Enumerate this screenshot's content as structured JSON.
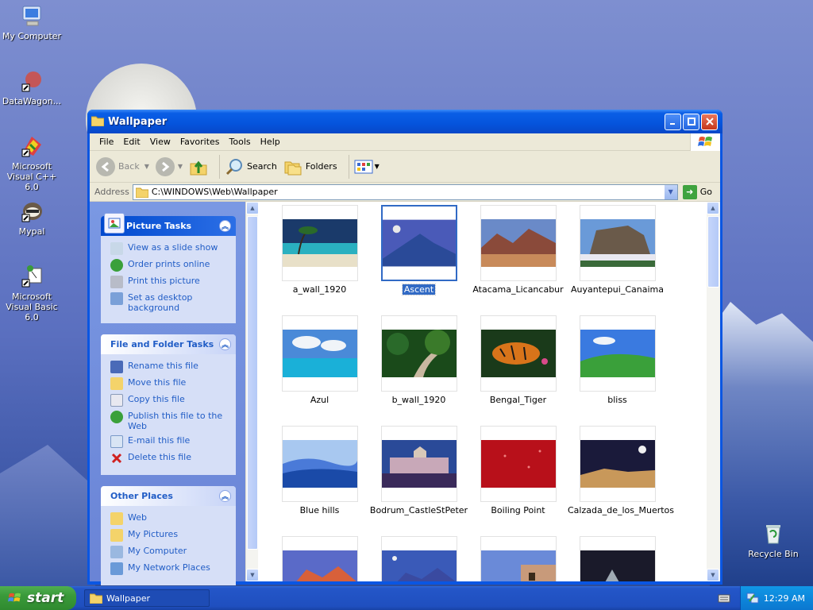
{
  "desktop": {
    "icons": [
      {
        "label": "My Computer"
      },
      {
        "label": "DataWagon..."
      },
      {
        "label": "Microsoft Visual C++ 6.0"
      },
      {
        "label": "Mypal"
      },
      {
        "label": "Microsoft Visual Basic 6.0"
      },
      {
        "label": "Recycle Bin"
      }
    ]
  },
  "window": {
    "title": "Wallpaper",
    "menu": [
      "File",
      "Edit",
      "View",
      "Favorites",
      "Tools",
      "Help"
    ],
    "toolbar": {
      "back": "Back",
      "search": "Search",
      "folders": "Folders"
    },
    "address": {
      "label": "Address",
      "value": "C:\\WINDOWS\\Web\\Wallpaper",
      "go": "Go"
    },
    "panels": {
      "picture_tasks": {
        "title": "Picture Tasks",
        "items": [
          "View as a slide show",
          "Order prints online",
          "Print this picture",
          "Set as desktop background"
        ]
      },
      "file_tasks": {
        "title": "File and Folder Tasks",
        "items": [
          "Rename this file",
          "Move this file",
          "Copy this file",
          "Publish this file to the Web",
          "E-mail this file",
          "Delete this file"
        ]
      },
      "other_places": {
        "title": "Other Places",
        "items": [
          "Web",
          "My Pictures",
          "My Computer",
          "My Network Places"
        ]
      }
    },
    "thumbnails": [
      {
        "name": "a_wall_1920",
        "selected": false
      },
      {
        "name": "Ascent",
        "selected": true
      },
      {
        "name": "Atacama_Licancabur",
        "selected": false
      },
      {
        "name": "Auyantepui_Canaima",
        "selected": false
      },
      {
        "name": "Azul",
        "selected": false
      },
      {
        "name": "b_wall_1920",
        "selected": false
      },
      {
        "name": "Bengal_Tiger",
        "selected": false
      },
      {
        "name": "bliss",
        "selected": false
      },
      {
        "name": "Blue hills",
        "selected": false
      },
      {
        "name": "Bodrum_CastleStPeter",
        "selected": false
      },
      {
        "name": "Boiling Point",
        "selected": false
      },
      {
        "name": "Calzada_de_los_Muertos",
        "selected": false
      }
    ]
  },
  "taskbar": {
    "start": "start",
    "task": "Wallpaper",
    "clock": "12:29 AM"
  },
  "colors": {
    "xp_blue": "#0a56e2",
    "task_pane": "#6a84d6",
    "link": "#215dc6",
    "selection": "#316ac5",
    "start_green": "#3a9a3a"
  }
}
